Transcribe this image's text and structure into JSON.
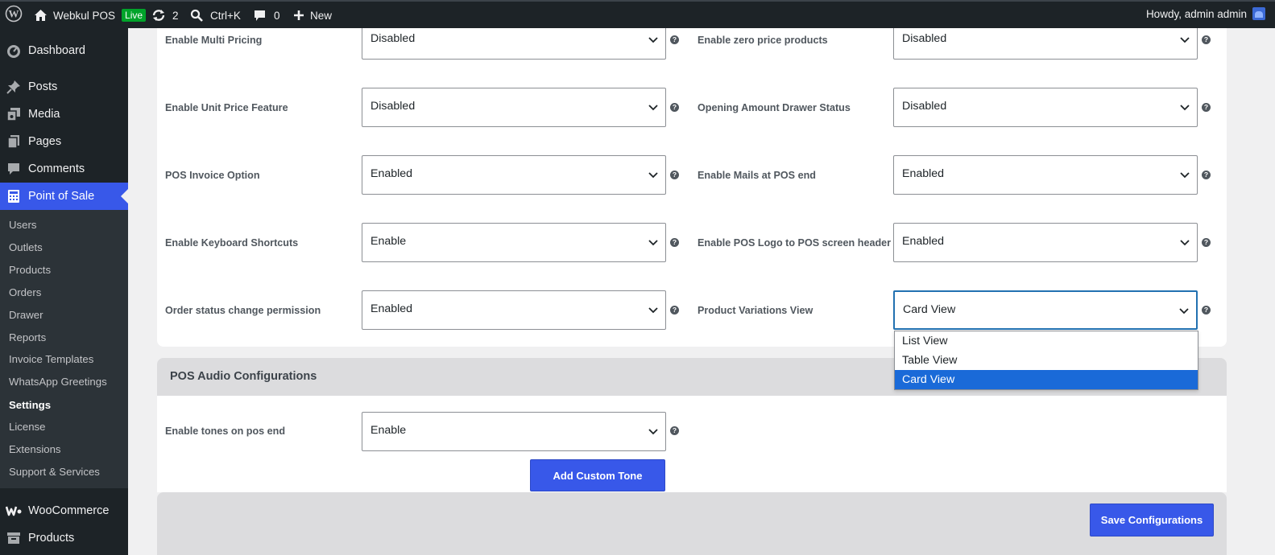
{
  "admin_bar": {
    "site_name": "Webkul POS",
    "live_badge": "Live",
    "updates_count": "2",
    "search_shortcut": "Ctrl+K",
    "comments_count": "0",
    "new_label": "New",
    "howdy": "Howdy, admin admin"
  },
  "sidebar": {
    "top_items": [
      {
        "label": "Dashboard",
        "icon": "dashboard-icon"
      },
      {
        "label": "Posts",
        "icon": "pin-icon"
      },
      {
        "label": "Media",
        "icon": "media-icon"
      },
      {
        "label": "Pages",
        "icon": "pages-icon"
      },
      {
        "label": "Comments",
        "icon": "comment-icon"
      },
      {
        "label": "Point of Sale",
        "icon": "calculator-icon"
      }
    ],
    "submenu": [
      "Users",
      "Outlets",
      "Products",
      "Orders",
      "Drawer",
      "Reports",
      "Invoice Templates",
      "WhatsApp Greetings",
      "Settings",
      "License",
      "Extensions",
      "Support & Services"
    ],
    "current_submenu": "Settings",
    "bottom_items": [
      {
        "label": "WooCommerce",
        "icon": "woocommerce-icon"
      },
      {
        "label": "Products",
        "icon": "archive-icon"
      }
    ]
  },
  "settings": {
    "left": [
      {
        "label": "Enable Multi Pricing",
        "value": "Disabled"
      },
      {
        "label": "Enable Unit Price Feature",
        "value": "Disabled"
      },
      {
        "label": "POS Invoice Option",
        "value": "Enabled"
      },
      {
        "label": "Enable Keyboard Shortcuts",
        "value": "Enable"
      },
      {
        "label": "Order status change permission",
        "value": "Enabled"
      }
    ],
    "right": [
      {
        "label": "Enable zero price products",
        "value": "Disabled"
      },
      {
        "label": "Opening Amount Drawer Status",
        "value": "Disabled"
      },
      {
        "label": "Enable Mails at POS end",
        "value": "Enabled"
      },
      {
        "label": "Enable POS Logo to POS screen header",
        "value": "Enabled"
      },
      {
        "label": "Product Variations View",
        "value": "Card View"
      }
    ]
  },
  "variations_dropdown": {
    "options": [
      "List View",
      "Table View",
      "Card View"
    ],
    "selected": "Card View"
  },
  "audio": {
    "section_title": "POS Audio Configurations",
    "tones_label": "Enable tones on pos end",
    "tones_value": "Enable",
    "add_tone_button": "Add Custom Tone"
  },
  "save_button": "Save Configurations",
  "help_glyph": "?",
  "colors": {
    "accent": "#3858e9",
    "admin_bar": "#1d2327",
    "live_badge": "#00a32a",
    "dropdown_highlight": "#1a6ad8"
  }
}
